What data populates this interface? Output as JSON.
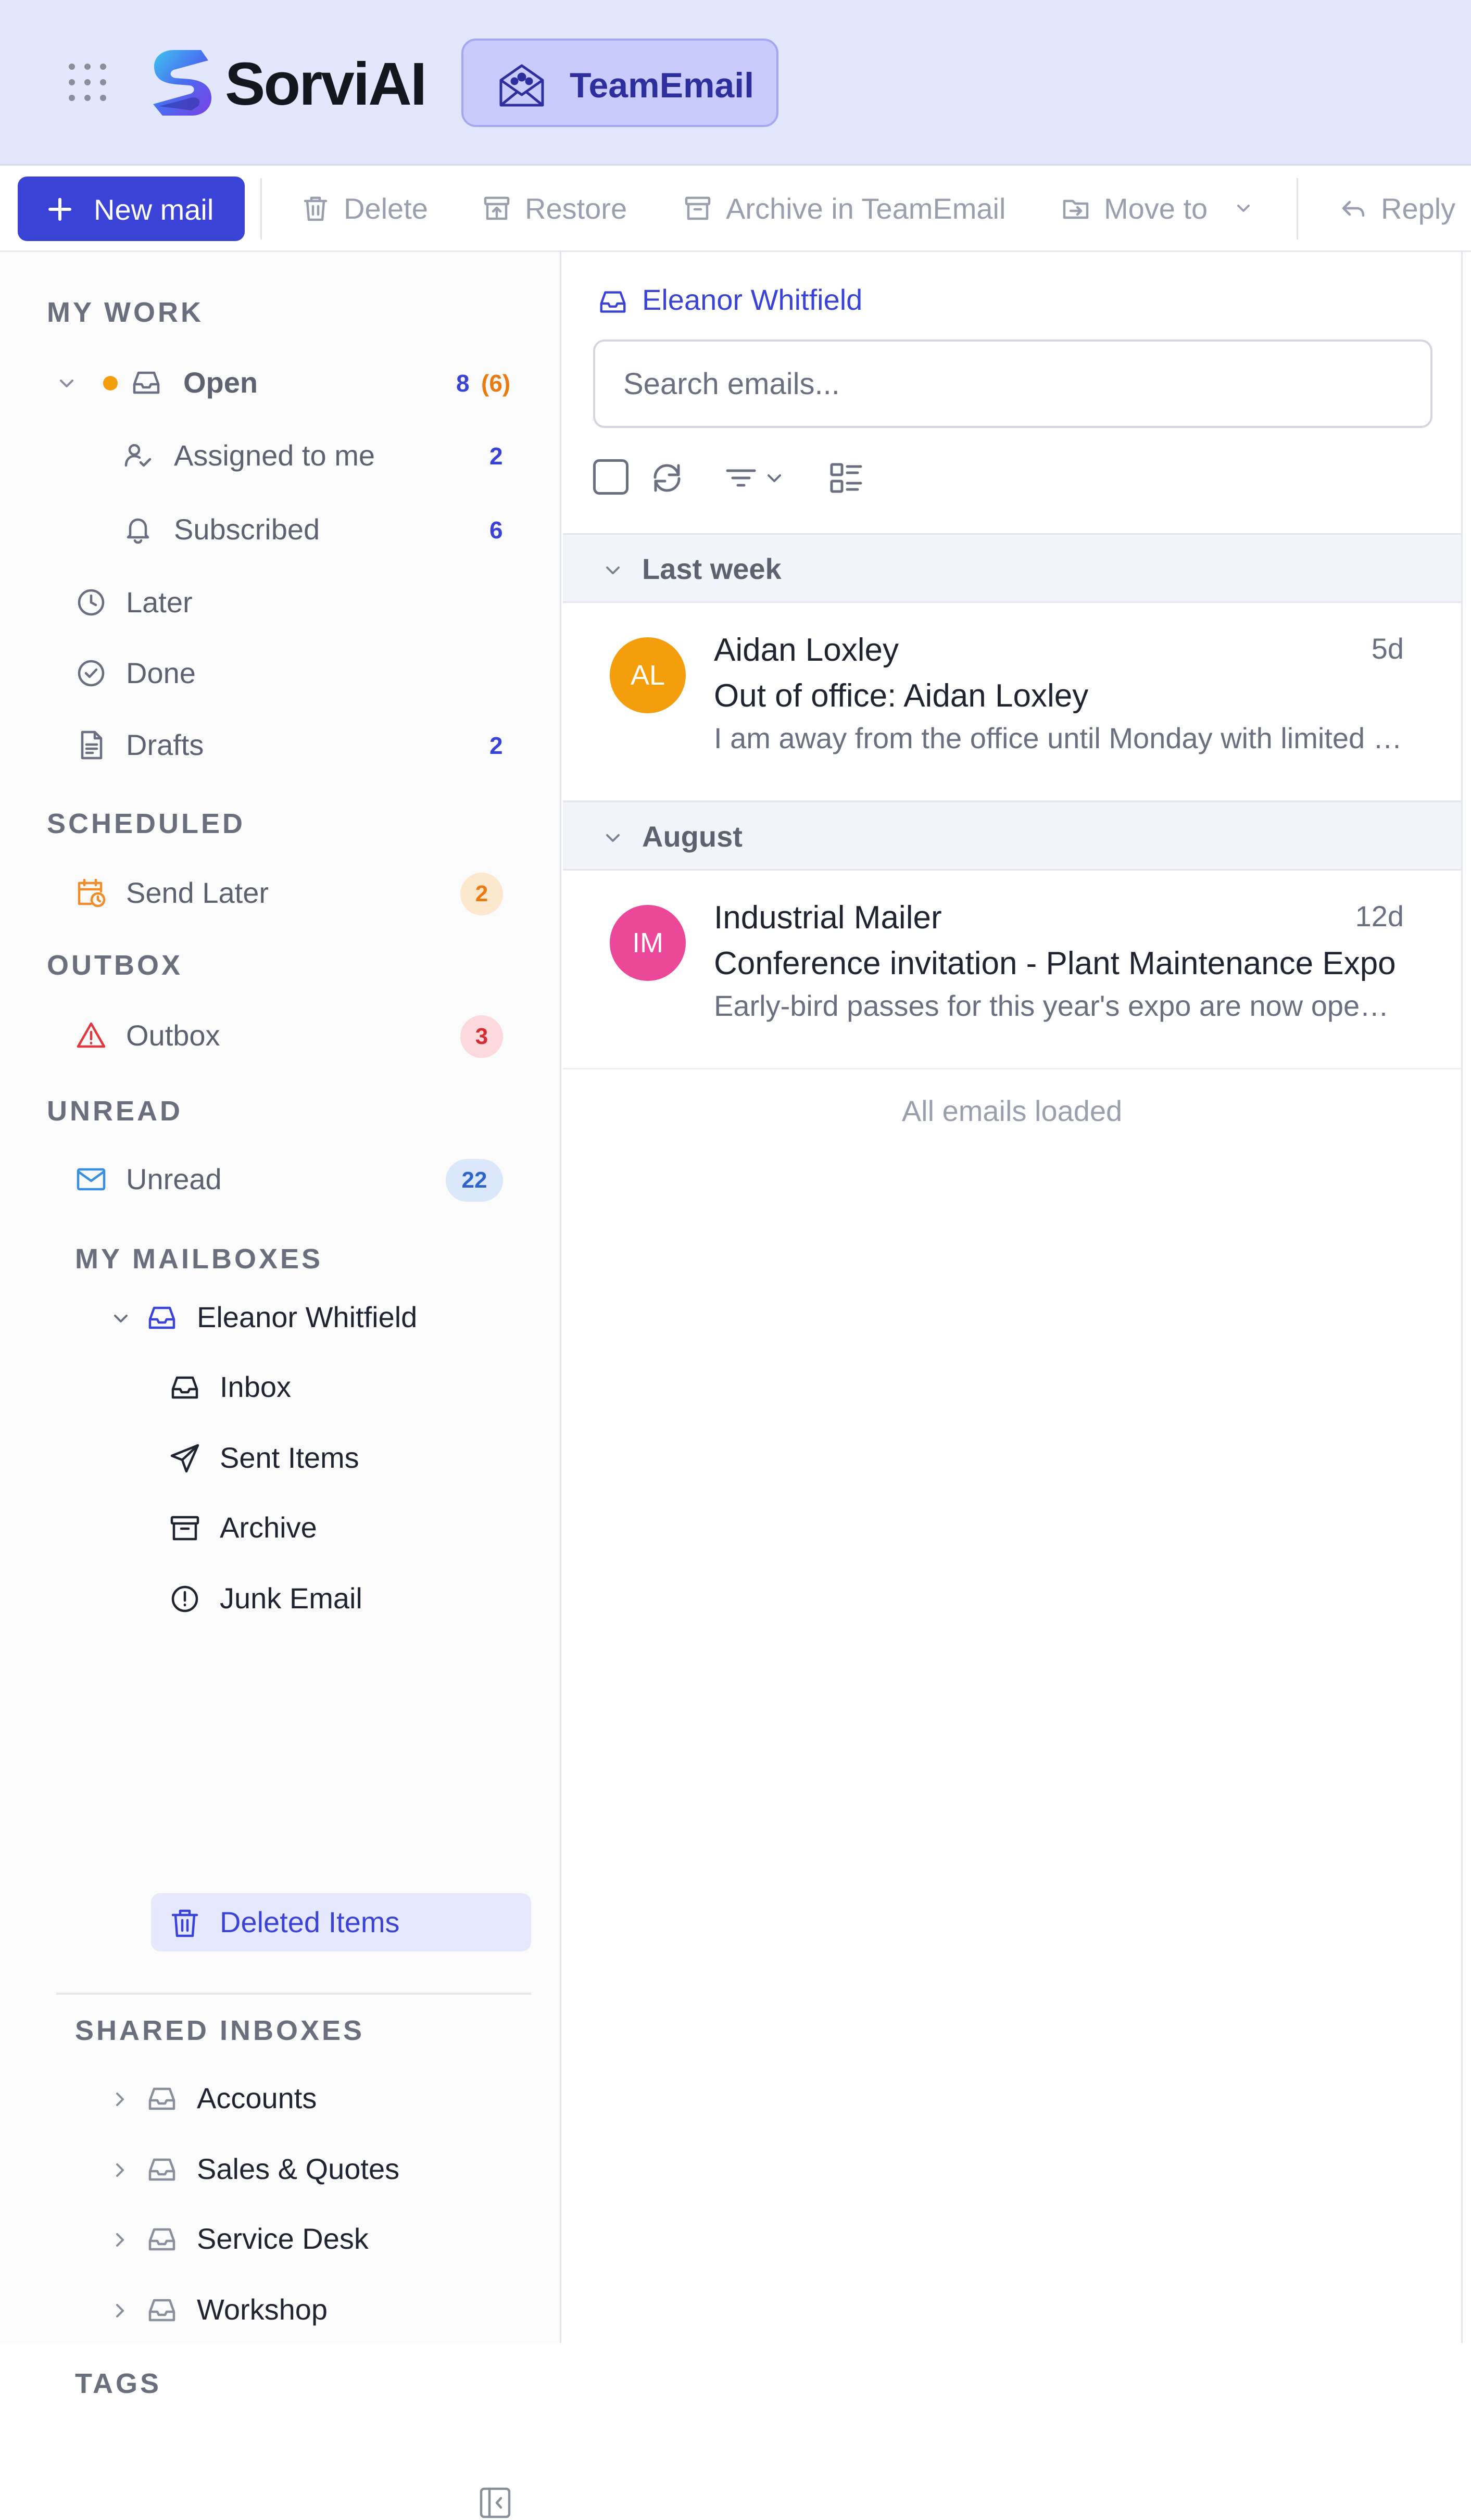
{
  "app": {
    "brand": "SorviAI",
    "product": "TeamEmail",
    "accent_color": "#3b43d6"
  },
  "toolbar": {
    "new_mail": "New mail",
    "delete": "Delete",
    "restore": "Restore",
    "archive": "Archive in TeamEmail",
    "move_to": "Move to",
    "reply": "Reply"
  },
  "sidebar": {
    "my_work": {
      "heading": "MY WORK",
      "open": {
        "label": "Open",
        "count": "8",
        "count_extra": "(6)"
      },
      "assigned": {
        "label": "Assigned to me",
        "count": "2"
      },
      "subscribed": {
        "label": "Subscribed",
        "count": "6"
      },
      "later": {
        "label": "Later"
      },
      "done": {
        "label": "Done"
      },
      "drafts": {
        "label": "Drafts",
        "count": "2"
      }
    },
    "scheduled": {
      "heading": "SCHEDULED",
      "send_later": {
        "label": "Send Later",
        "count": "2"
      }
    },
    "outbox": {
      "heading": "OUTBOX",
      "outbox": {
        "label": "Outbox",
        "count": "3"
      }
    },
    "unread": {
      "heading": "UNREAD",
      "unread": {
        "label": "Unread",
        "count": "22"
      }
    },
    "my_mailboxes": {
      "heading": "MY MAILBOXES",
      "owner": "Eleanor Whitfield",
      "folders": [
        "Inbox",
        "Sent Items",
        "Archive",
        "Junk Email",
        "Deleted Items"
      ],
      "selected": "Deleted Items"
    },
    "shared_inboxes": {
      "heading": "SHARED INBOXES",
      "items": [
        "Accounts",
        "Sales & Quotes",
        "Service Desk",
        "Workshop"
      ]
    },
    "tags": {
      "heading": "TAGS"
    }
  },
  "mail_list": {
    "mailbox_title": "Eleanor Whitfield",
    "search_placeholder": "Search emails...",
    "groups": [
      {
        "label": "Last week",
        "emails": [
          {
            "initials": "AL",
            "avatar_color": "#f59e0b",
            "sender": "Aidan Loxley",
            "age": "5d",
            "subject": "Out of office: Aidan Loxley",
            "preview": "I am away from the office until Monday with limited access to email. For urgent matters please contact the office."
          }
        ]
      },
      {
        "label": "August",
        "emails": [
          {
            "initials": "IM",
            "avatar_color": "#ec4899",
            "sender": "Industrial Mailer",
            "age": "12d",
            "subject": "Conference invitation - Plant Maintenance Expo",
            "preview": "Early-bird passes for this year's expo are now open. Reserve your place today."
          }
        ]
      }
    ],
    "footer": "All emails loaded"
  }
}
